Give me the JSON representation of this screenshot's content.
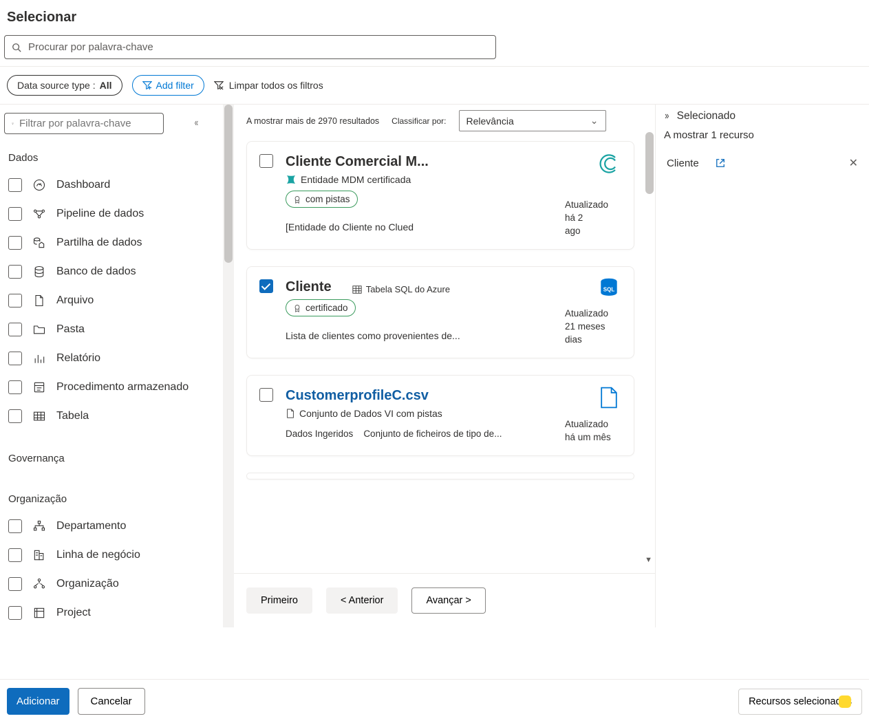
{
  "header": {
    "title": "Selecionar"
  },
  "search": {
    "placeholder": "Procurar por palavra-chave"
  },
  "filters": {
    "dataSourceType_prefix": "Data source type : ",
    "dataSourceType_value": "All",
    "addFilter": "Add filter",
    "clearAll": "Limpar todos os filtros"
  },
  "sidebar": {
    "filter_placeholder": "Filtrar por palavra-chave",
    "sections": {
      "dados": {
        "head": "Dados",
        "items": [
          {
            "label": "Dashboard"
          },
          {
            "label": "Pipeline de dados"
          },
          {
            "label": "Partilha de dados"
          },
          {
            "label": "Banco de dados"
          },
          {
            "label": "Arquivo"
          },
          {
            "label": "Pasta"
          },
          {
            "label": "Relatório"
          },
          {
            "label": "Procedimento armazenado"
          },
          {
            "label": "Tabela"
          }
        ]
      },
      "governanca": {
        "head": "Governança"
      },
      "organizacao": {
        "head": "Organização",
        "items": [
          {
            "label": "Departamento"
          },
          {
            "label": "Linha de negócio"
          },
          {
            "label": "Organização"
          },
          {
            "label": "Project"
          }
        ]
      }
    }
  },
  "results": {
    "count_text": "A mostrar mais de 2970 resultados",
    "sort_label": "Classificar por:",
    "sort_value": "Relevância",
    "cards": [
      {
        "title": "Cliente Comercial M...",
        "subtype": "Entidade MDM certificada",
        "badge": "com pistas",
        "desc": "[Entidade do Cliente no Clued",
        "updated": "Atualizado há 2",
        "updated2": "ago"
      },
      {
        "title": "Cliente",
        "subtype": "Tabela SQL do Azure",
        "badge": "certificado",
        "desc": "Lista de clientes como provenientes de...",
        "updated": "Atualizado 21 meses",
        "updated2": "dias"
      },
      {
        "title": "CustomerprofileC.csv",
        "subtype": "Conjunto de Dados VI com pistas",
        "desc": "Dados Ingeridos    Conjunto de ficheiros de tipo de...",
        "updated": "Atualizado há um mês"
      }
    ]
  },
  "pager": {
    "first": "Primeiro",
    "prev": "<  Anterior",
    "next": "Avançar >"
  },
  "right": {
    "head": "Selecionado",
    "sub": "A mostrar 1 recurso",
    "item": "Cliente"
  },
  "footer": {
    "add": "Adicionar",
    "cancel": "Cancelar",
    "selected": "Recursos selecionados"
  }
}
